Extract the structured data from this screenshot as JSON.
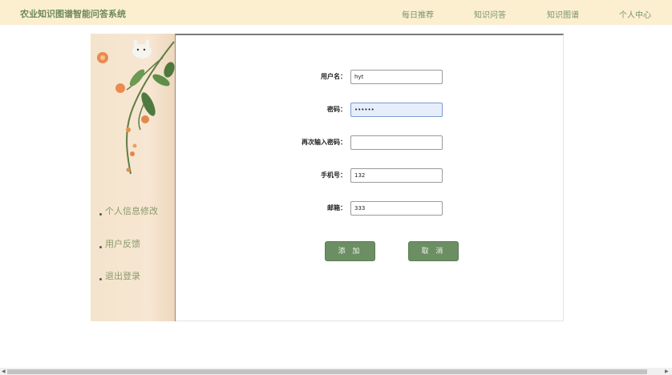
{
  "header": {
    "brand": "农业知识图谱智能问答系统",
    "nav": [
      "每日推荐",
      "知识问答",
      "知识图谱",
      "个人中心"
    ]
  },
  "sidebar": {
    "items": [
      "个人信息修改",
      "用户反馈",
      "退出登录"
    ]
  },
  "form": {
    "username_label": "用户名：",
    "username_value": "hyt",
    "password_label": "密码：",
    "password_value": "••••••",
    "confirm_label": "再次输入密码：",
    "confirm_value": "",
    "phone_label": "手机号：",
    "phone_value": "132",
    "email_label": "邮箱：",
    "email_value": "333",
    "add_button": "添 加",
    "cancel_button": "取 消"
  },
  "colors": {
    "topbar_bg": "#fbefd0",
    "accent_green": "#6b8e63",
    "sidebar_bg": "#f4e4cc"
  }
}
